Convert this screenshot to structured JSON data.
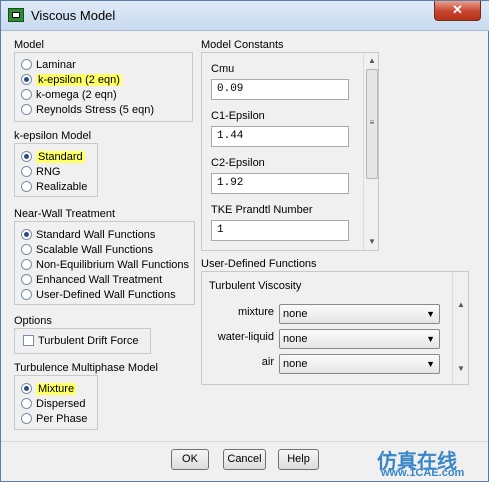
{
  "window": {
    "title": "Viscous Model",
    "close_symbol": "✕"
  },
  "model": {
    "label": "Model",
    "options": [
      {
        "label": "Laminar",
        "selected": false,
        "highlighted": false
      },
      {
        "label": "k-epsilon (2 eqn)",
        "selected": true,
        "highlighted": true
      },
      {
        "label": "k-omega (2 eqn)",
        "selected": false,
        "highlighted": false
      },
      {
        "label": "Reynolds Stress (5 eqn)",
        "selected": false,
        "highlighted": false
      }
    ]
  },
  "kepsilon_model": {
    "label": "k-epsilon Model",
    "options": [
      {
        "label": "Standard",
        "selected": true,
        "highlighted": true
      },
      {
        "label": "RNG",
        "selected": false,
        "highlighted": false
      },
      {
        "label": "Realizable",
        "selected": false,
        "highlighted": false
      }
    ]
  },
  "near_wall": {
    "label": "Near-Wall Treatment",
    "options": [
      {
        "label": "Standard Wall Functions",
        "selected": true
      },
      {
        "label": "Scalable Wall Functions",
        "selected": false
      },
      {
        "label": "Non-Equilibrium Wall Functions",
        "selected": false
      },
      {
        "label": "Enhanced Wall Treatment",
        "selected": false
      },
      {
        "label": "User-Defined Wall Functions",
        "selected": false
      }
    ]
  },
  "options": {
    "label": "Options",
    "turbulent_drift_force": "Turbulent Drift Force",
    "checked": false
  },
  "turbulence_multiphase": {
    "label": "Turbulence Multiphase Model",
    "options": [
      {
        "label": "Mixture",
        "selected": true,
        "highlighted": true
      },
      {
        "label": "Dispersed",
        "selected": false,
        "highlighted": false
      },
      {
        "label": "Per Phase",
        "selected": false,
        "highlighted": false
      }
    ]
  },
  "model_constants": {
    "label": "Model Constants",
    "fields": [
      {
        "label": "Cmu",
        "value": "0.09"
      },
      {
        "label": "C1-Epsilon",
        "value": "1.44"
      },
      {
        "label": "C2-Epsilon",
        "value": "1.92"
      },
      {
        "label": "TKE Prandtl Number",
        "value": "1"
      }
    ]
  },
  "udf": {
    "label": "User-Defined Functions",
    "turbulent_viscosity_label": "Turbulent Viscosity",
    "rows": [
      {
        "label": "mixture",
        "value": "none"
      },
      {
        "label": "water-liquid",
        "value": "none"
      },
      {
        "label": "air",
        "value": "none"
      }
    ]
  },
  "buttons": {
    "ok": "OK",
    "cancel": "Cancel",
    "help": "Help"
  },
  "watermark": {
    "chinese": "仿真在线",
    "site": "www.1CAE.com"
  }
}
